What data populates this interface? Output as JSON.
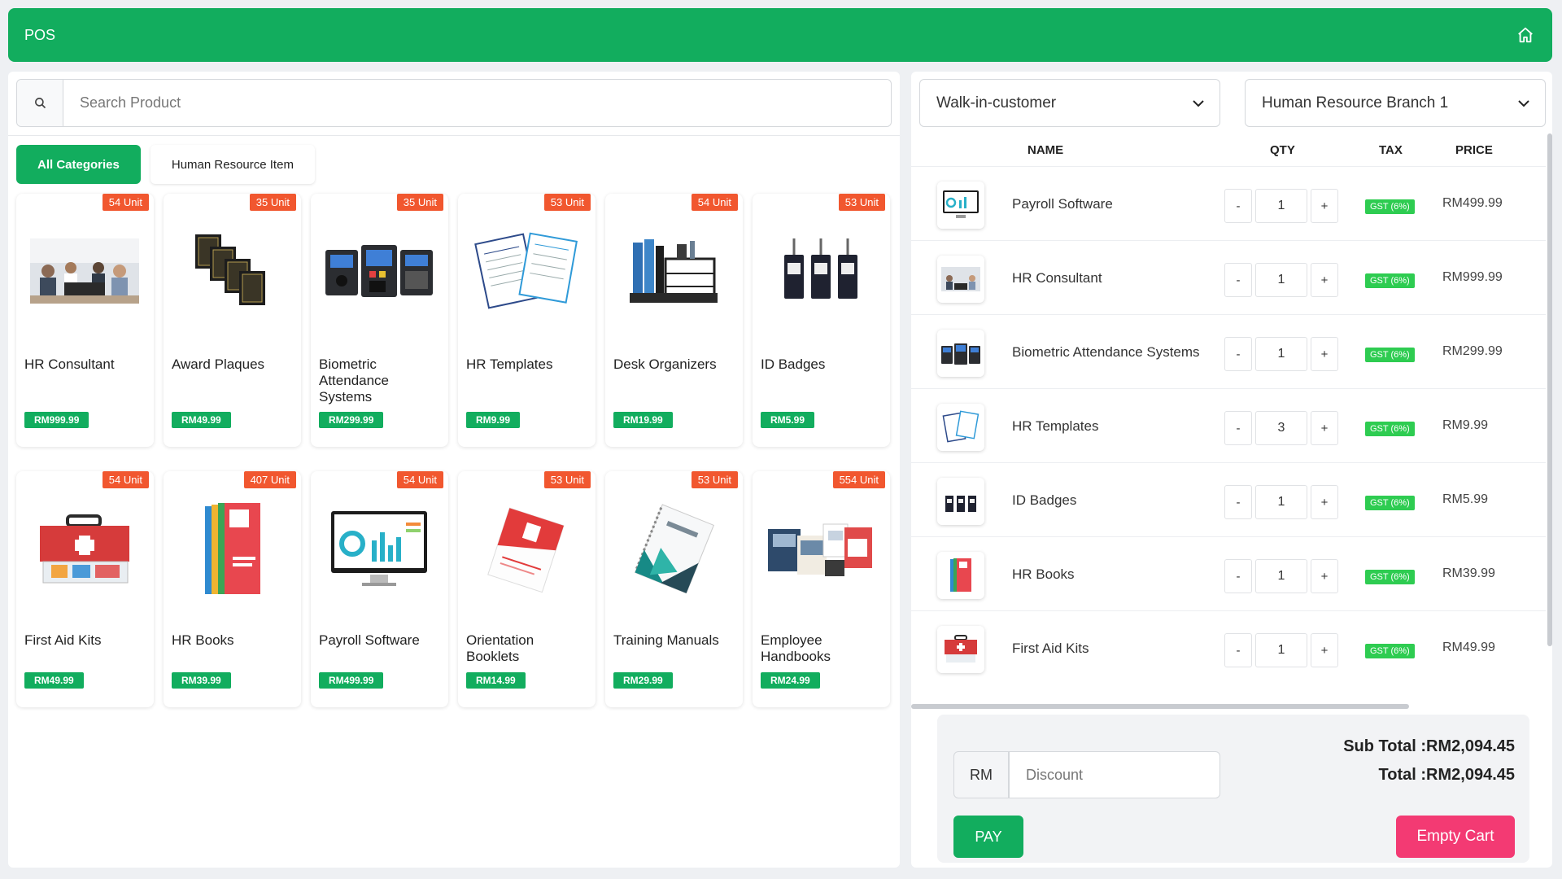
{
  "header": {
    "title": "POS",
    "home_icon": "home-icon"
  },
  "search": {
    "placeholder": "Search Product",
    "icon": "search-icon"
  },
  "categories": [
    {
      "label": "All Categories",
      "active": true
    },
    {
      "label": "Human Resource Item",
      "active": false
    }
  ],
  "products": [
    {
      "name": "HR Consultant",
      "price": "RM999.99",
      "stock": "54 Unit"
    },
    {
      "name": "Award Plaques",
      "price": "RM49.99",
      "stock": "35 Unit"
    },
    {
      "name": "Biometric Attendance Systems",
      "price": "RM299.99",
      "stock": "35 Unit"
    },
    {
      "name": "HR Templates",
      "price": "RM9.99",
      "stock": "53 Unit"
    },
    {
      "name": "Desk Organizers",
      "price": "RM19.99",
      "stock": "54 Unit"
    },
    {
      "name": "ID Badges",
      "price": "RM5.99",
      "stock": "53 Unit"
    },
    {
      "name": "First Aid Kits",
      "price": "RM49.99",
      "stock": "54 Unit"
    },
    {
      "name": "HR Books",
      "price": "RM39.99",
      "stock": "407 Unit"
    },
    {
      "name": "Payroll Software",
      "price": "RM499.99",
      "stock": "54 Unit"
    },
    {
      "name": "Orientation Booklets",
      "price": "RM14.99",
      "stock": "53 Unit"
    },
    {
      "name": "Training Manuals",
      "price": "RM29.99",
      "stock": "53 Unit"
    },
    {
      "name": "Employee Handbooks",
      "price": "RM24.99",
      "stock": "554 Unit"
    }
  ],
  "cart": {
    "customer": "Walk-in-customer",
    "branch": "Human Resource Branch 1",
    "columns": {
      "name": "NAME",
      "qty": "QTY",
      "tax": "TAX",
      "price": "PRICE"
    },
    "items": [
      {
        "name": "Payroll Software",
        "qty": "1",
        "tax": "GST (6%)",
        "price": "RM499.99"
      },
      {
        "name": "HR Consultant",
        "qty": "1",
        "tax": "GST (6%)",
        "price": "RM999.99"
      },
      {
        "name": "Biometric Attendance Systems",
        "qty": "1",
        "tax": "GST (6%)",
        "price": "RM299.99"
      },
      {
        "name": "HR Templates",
        "qty": "3",
        "tax": "GST (6%)",
        "price": "RM9.99"
      },
      {
        "name": "ID Badges",
        "qty": "1",
        "tax": "GST (6%)",
        "price": "RM5.99"
      },
      {
        "name": "HR Books",
        "qty": "1",
        "tax": "GST (6%)",
        "price": "RM39.99"
      },
      {
        "name": "First Aid Kits",
        "qty": "1",
        "tax": "GST (6%)",
        "price": "RM49.99"
      }
    ],
    "minus_label": "-",
    "plus_label": "+"
  },
  "summary": {
    "currency_prefix": "RM",
    "discount_placeholder": "Discount",
    "subtotal_text": "Sub Total :RM2,094.45",
    "total_text": "Total :RM2,094.45",
    "pay_label": "PAY",
    "empty_label": "Empty Cart"
  },
  "colors": {
    "brand": "#12ad5e",
    "stock_badge": "#f1572f",
    "tax_badge": "#2ecc51",
    "danger": "#f33a73"
  }
}
